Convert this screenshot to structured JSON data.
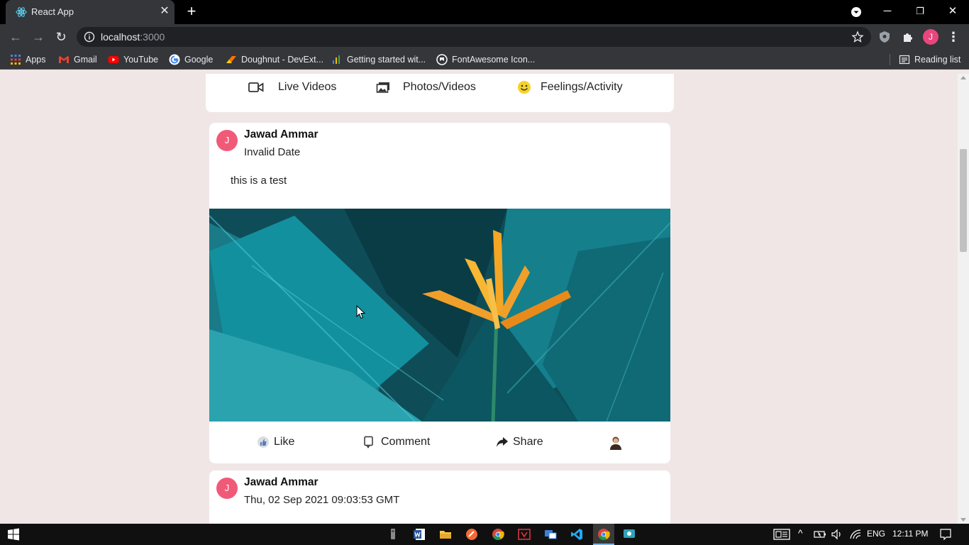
{
  "browser": {
    "tab_title": "React App",
    "url_host": "localhost",
    "url_port": ":3000",
    "bookmarks": [
      {
        "label": "Apps",
        "icon": "apps-grid-icon"
      },
      {
        "label": "Gmail",
        "icon": "gmail-icon"
      },
      {
        "label": "YouTube",
        "icon": "youtube-icon"
      },
      {
        "label": "Google",
        "icon": "google-icon"
      },
      {
        "label": "Doughnut - DevExt...",
        "icon": "devextreme-icon"
      },
      {
        "label": "Getting started wit...",
        "icon": "chart-icon"
      },
      {
        "label": "FontAwesome Icon...",
        "icon": "fontawesome-icon"
      }
    ],
    "reading_list": "Reading list",
    "profile_initial": "J"
  },
  "composer": {
    "live_videos": "Live Videos",
    "photos_videos": "Photos/Videos",
    "feelings_activity": "Feelings/Activity"
  },
  "posts": [
    {
      "avatar_initial": "J",
      "author": "Jawad Ammar",
      "date": "Invalid Date",
      "text": "this is a test",
      "image": "teal-leaves-orange-flower",
      "actions": {
        "like": "Like",
        "comment": "Comment",
        "share": "Share"
      }
    },
    {
      "avatar_initial": "J",
      "author": "Jawad Ammar",
      "date": "Thu, 02 Sep 2021 09:03:53 GMT"
    }
  ],
  "taskbar": {
    "language": "ENG",
    "time": "12:11 PM"
  },
  "colors": {
    "page_bg": "#f0e6e6",
    "avatar": "#f05a78",
    "chrome_dark": "#35363a"
  }
}
